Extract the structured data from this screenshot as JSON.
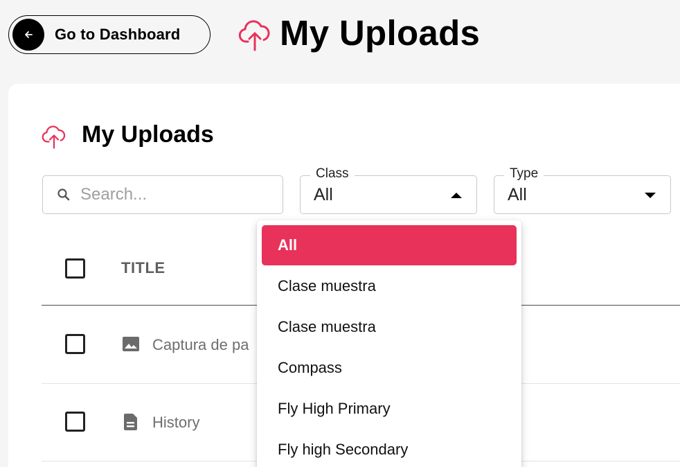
{
  "header": {
    "back_label": "Go to Dashboard",
    "title": "My Uploads",
    "upload_icon": "cloud-upload-icon",
    "accent": "#e8325a"
  },
  "card": {
    "title": "My Uploads",
    "search": {
      "placeholder": "Search..."
    },
    "class_filter": {
      "label": "Class",
      "value": "All"
    },
    "type_filter": {
      "label": "Type",
      "value": "All"
    }
  },
  "table": {
    "columns": [
      "TITLE"
    ],
    "rows": [
      {
        "title": "Captura de pa",
        "icon": "image-icon"
      },
      {
        "title": "History",
        "icon": "document-icon"
      }
    ]
  },
  "dropdown": {
    "selected_color": "#e8325a",
    "options": [
      "All",
      "Clase muestra",
      "Clase muestra",
      "Compass",
      "Fly High Primary",
      "Fly high Secondary"
    ]
  }
}
